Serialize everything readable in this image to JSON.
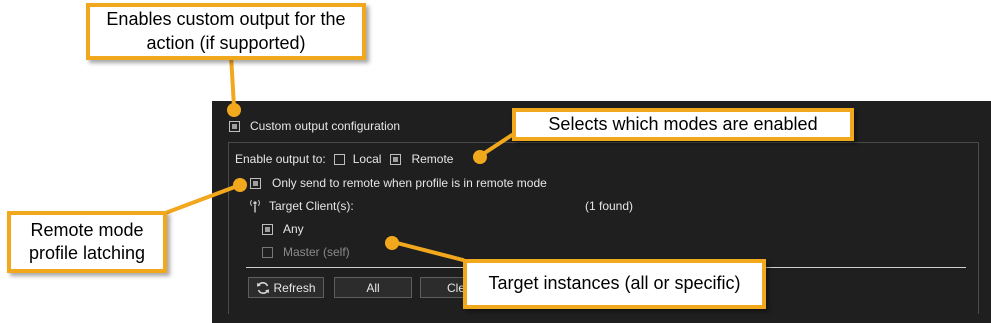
{
  "panel": {
    "custom_output_label": "Custom output configuration",
    "enable_output_label": "Enable output to:",
    "local_label": "Local",
    "remote_label": "Remote",
    "only_remote_label": "Only send to remote when profile is in remote mode",
    "target_clients_label": "Target Client(s):",
    "found_count": "(1 found)",
    "any_label": "Any",
    "master_label": "Master (self)",
    "refresh_label": "Refresh",
    "all_label": "All",
    "clear_label_partial": "Cle",
    "checkbox_state": {
      "custom_output": true,
      "local": false,
      "remote": true,
      "only_remote": true,
      "any": true,
      "master": false
    }
  },
  "callouts": {
    "custom_output": "Enables custom output for the action (if supported)",
    "custom_output_line1": "Enables custom output for the",
    "custom_output_line2": "action (if supported)",
    "modes": "Selects which modes are enabled",
    "latching_line1": "Remote mode",
    "latching_line2": "profile latching",
    "targets": "Target instances (all or specific)"
  },
  "colors": {
    "callout_border": "#f2a81d",
    "panel_bg": "#1f1f1f"
  }
}
